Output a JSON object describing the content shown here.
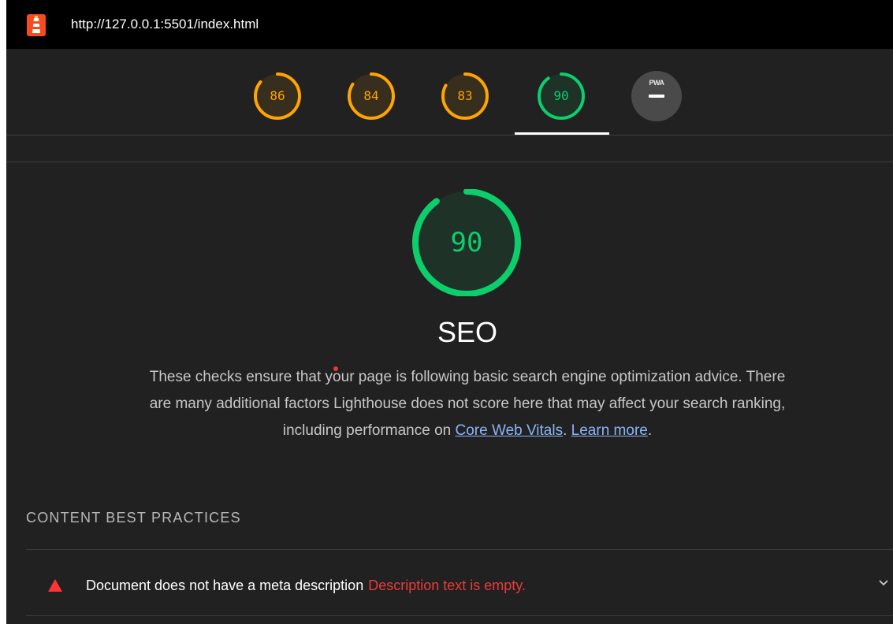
{
  "header": {
    "url": "http://127.0.0.1:5501/index.html",
    "logo_icon": "lighthouse-icon"
  },
  "gauges": [
    {
      "score": "86",
      "value": 86,
      "color": "#ffa400"
    },
    {
      "score": "84",
      "value": 84,
      "color": "#ffa400"
    },
    {
      "score": "83",
      "value": 83,
      "color": "#ffa400"
    },
    {
      "score": "90",
      "value": 90,
      "color": "#0cce6b",
      "active": true
    },
    {
      "label": "PWA",
      "icon": "pwa-icon",
      "color": "#4a4a4a"
    }
  ],
  "category": {
    "score": "90",
    "value": 90,
    "color": "#0cce6b",
    "title": "SEO",
    "description": "These checks ensure that your page is following basic search engine optimization advice. There are many additional factors Lighthouse does not score here that may affect your search ranking, including performance on",
    "link1": "Core Web Vitals",
    "between": ".",
    "link2": "Learn more",
    "end": "."
  },
  "section": {
    "title": "CONTENT BEST PRACTICES"
  },
  "audit": {
    "title": "Document does not have a meta description",
    "detail": "Description text is empty.",
    "status_icon": "fail-triangle-icon",
    "expand_icon": "chevron-down-icon"
  },
  "colors": {
    "pass": "#0cce6b",
    "average": "#ffa400",
    "fail": "#ff3333",
    "link": "#8ab4f8"
  }
}
